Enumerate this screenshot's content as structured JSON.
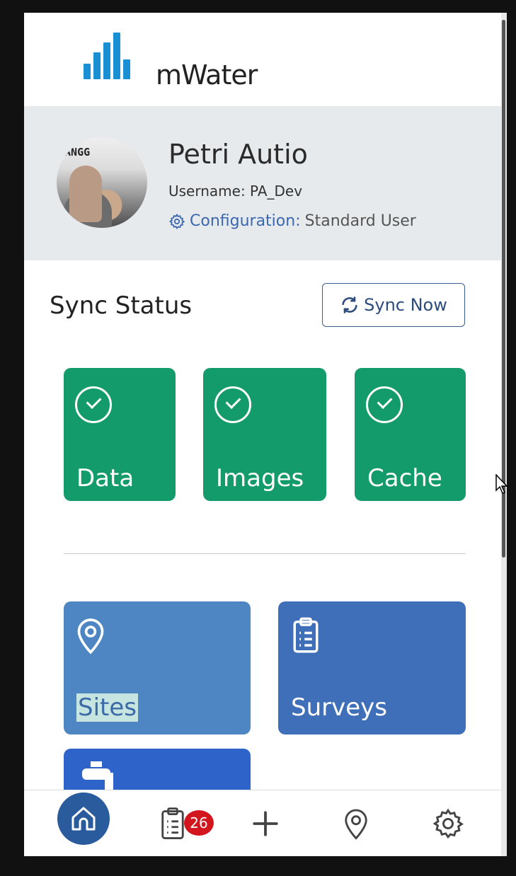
{
  "app": {
    "logo_text": "mWater"
  },
  "profile": {
    "name": "Petri Autio",
    "username": "Username: PA_Dev",
    "config_link": "Configuration:",
    "config_value": "Standard User",
    "avatar_sign_text": "CANGG"
  },
  "sync": {
    "title": "Sync Status",
    "button_label": "Sync Now",
    "tiles": [
      {
        "label": "Data",
        "status": "synced"
      },
      {
        "label": "Images",
        "status": "synced"
      },
      {
        "label": "Cache",
        "status": "synced"
      }
    ]
  },
  "modules": {
    "sites_label": "Sites",
    "surveys_label": "Surveys"
  },
  "bottom_nav": {
    "surveys_badge": "26"
  },
  "colors": {
    "accent_green": "#149b6c",
    "sites_blue": "#4d86c2",
    "surveys_blue": "#3f6fb8",
    "nav_active": "#2a5b9c",
    "badge_red": "#d3151d"
  }
}
